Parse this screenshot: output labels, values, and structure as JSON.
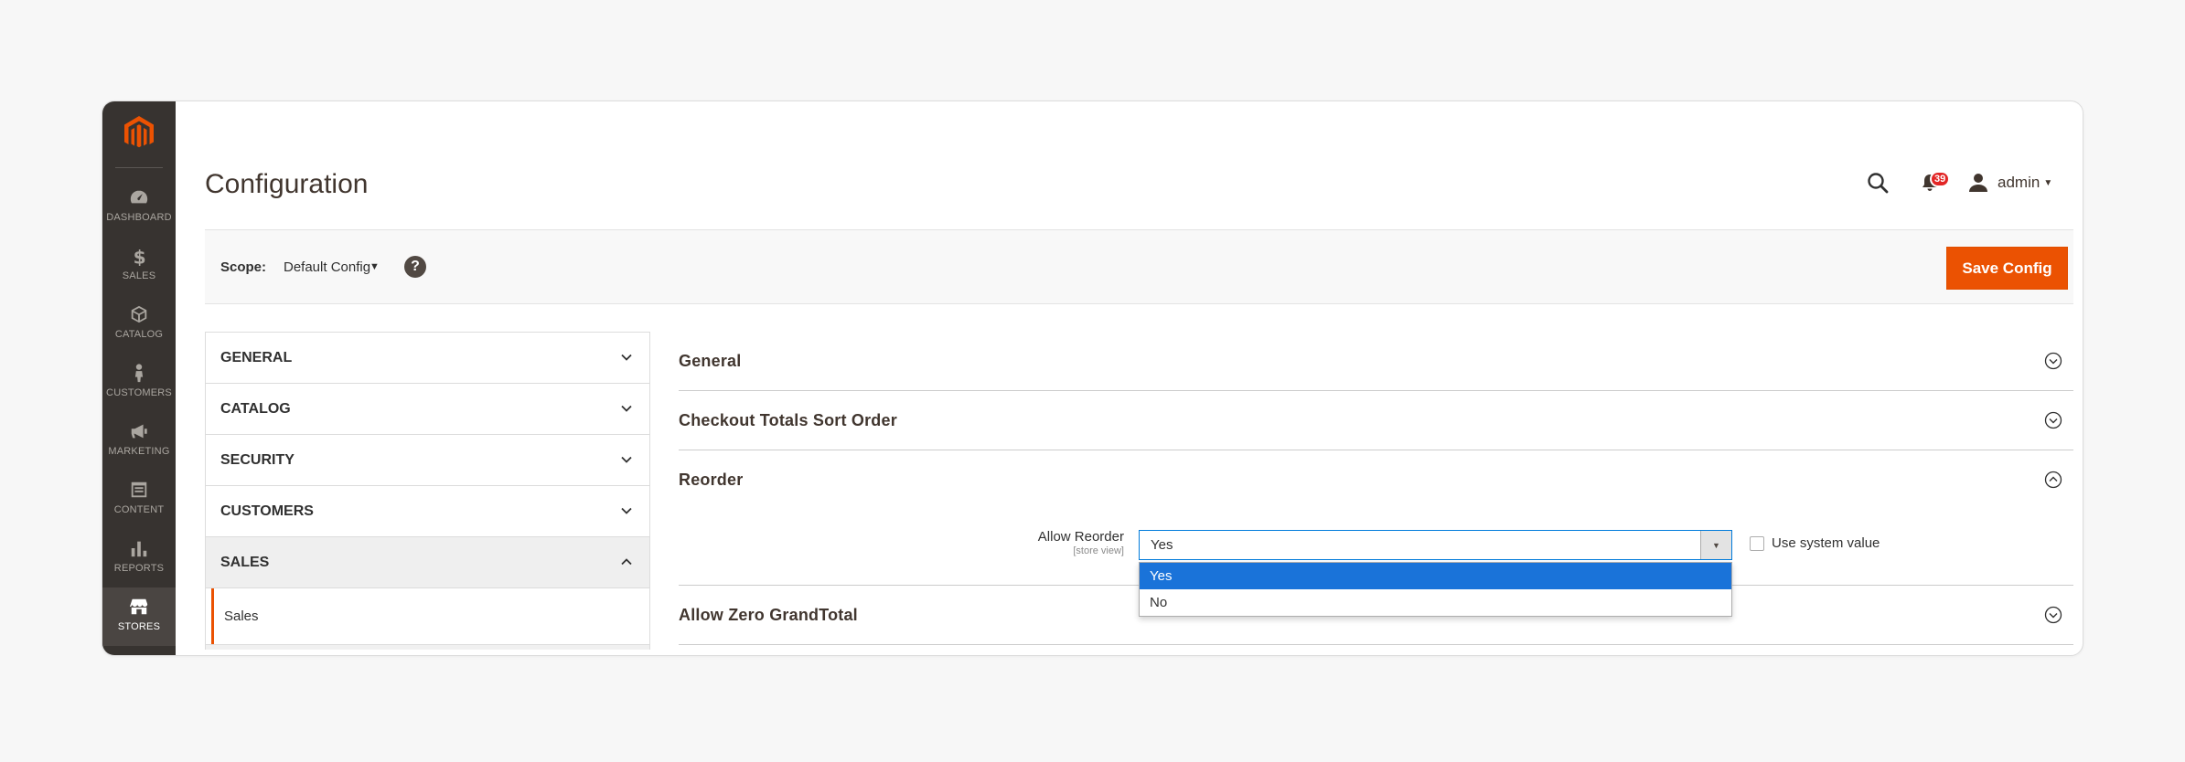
{
  "sidebar": {
    "items": [
      {
        "label": "DASHBOARD",
        "icon": "dashboard-icon"
      },
      {
        "label": "SALES",
        "icon": "dollar-icon"
      },
      {
        "label": "CATALOG",
        "icon": "cube-icon"
      },
      {
        "label": "CUSTOMERS",
        "icon": "person-icon"
      },
      {
        "label": "MARKETING",
        "icon": "megaphone-icon"
      },
      {
        "label": "CONTENT",
        "icon": "content-icon"
      },
      {
        "label": "REPORTS",
        "icon": "bar-chart-icon"
      },
      {
        "label": "STORES",
        "icon": "store-icon"
      }
    ],
    "active": "STORES"
  },
  "header": {
    "title": "Configuration",
    "notifications_count": "39",
    "user": "admin"
  },
  "scope": {
    "label": "Scope:",
    "value": "Default Config",
    "help": "?",
    "save_label": "Save Config"
  },
  "tabs": [
    {
      "label": "GENERAL"
    },
    {
      "label": "CATALOG"
    },
    {
      "label": "SECURITY"
    },
    {
      "label": "CUSTOMERS"
    },
    {
      "label": "SALES",
      "open": true,
      "sub": [
        "Sales"
      ]
    }
  ],
  "sections": [
    {
      "title": "General"
    },
    {
      "title": "Checkout Totals Sort Order"
    },
    {
      "title": "Reorder",
      "expanded": true
    },
    {
      "title": "Allow Zero GrandTotal"
    }
  ],
  "reorder": {
    "field_label": "Allow Reorder",
    "field_scope": "[store view]",
    "selected": "Yes",
    "options": [
      "Yes",
      "No"
    ],
    "use_system_value": "Use system value"
  },
  "colors": {
    "accent": "#eb5202",
    "sidebar": "#373330",
    "selected_option": "#1a73d9"
  }
}
